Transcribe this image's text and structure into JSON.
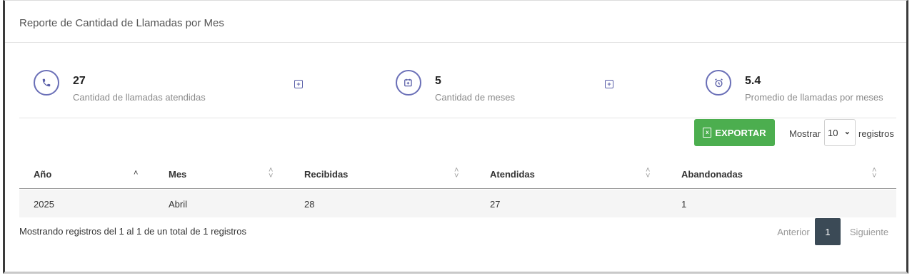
{
  "card": {
    "title": "Reporte de Cantidad de Llamadas por Mes"
  },
  "stats": [
    {
      "value": "27",
      "label": "Cantidad de llamadas atendidas",
      "icon": "phone-icon"
    },
    {
      "value": "5",
      "label": "Cantidad de meses",
      "icon": "calendar-icon"
    },
    {
      "value": "5.4",
      "label": "Promedio de llamadas por meses",
      "icon": "alarm-clock-icon"
    }
  ],
  "toolbar": {
    "export_label": "EXPORTAR",
    "show_label": "Mostrar",
    "page_size": "10",
    "records_label": "registros"
  },
  "table": {
    "headers": [
      "Año",
      "Mes",
      "Recibidas",
      "Atendidas",
      "Abandonadas"
    ],
    "rows": [
      [
        "2025",
        "Abril",
        "28",
        "27",
        "1"
      ]
    ]
  },
  "footer": {
    "info": "Mostrando registros del 1 al 1 de un total de 1 registros",
    "prev": "Anterior",
    "current_page": "1",
    "next": "Siguiente"
  },
  "colors": {
    "accent": "#6a6fb7",
    "export_button": "#4cae4f",
    "current_page": "#3b4a56"
  }
}
